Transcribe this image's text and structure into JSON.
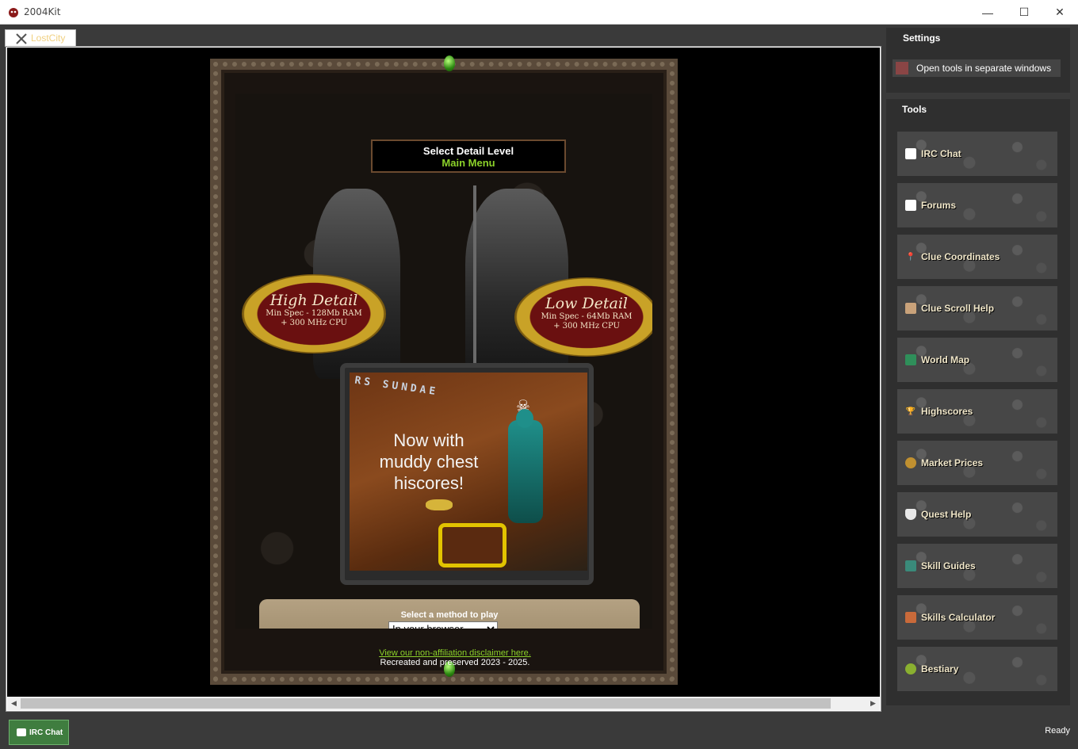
{
  "window": {
    "title": "2004Kit",
    "minimize": "—",
    "maximize": "☐",
    "close": "✕"
  },
  "tab": {
    "label": "LostCity"
  },
  "game": {
    "detail_title": "Select Detail Level",
    "detail_subtitle": "Main Menu",
    "high": {
      "title": "High Detail",
      "spec1": "Min Spec - 128Mb RAM",
      "spec2": "+ 300 MHz CPU"
    },
    "low": {
      "title": "Low Detail",
      "spec1": "Min Spec - 64Mb RAM",
      "spec2": "+ 300 MHz CPU"
    },
    "promo": {
      "logo": "RS SUNDAE",
      "headline": "Now with muddy chest hiscores!"
    },
    "method_label": "Select a method to play",
    "method_selected": "In your browser",
    "disclaimer_link": "View our non-affiliation disclaimer here.",
    "copyright": "Recreated and preserved 2023 - 2025."
  },
  "settings": {
    "title": "Settings",
    "toggle_label": "Open tools in separate windows"
  },
  "tools": {
    "title": "Tools",
    "items": [
      {
        "label": "IRC Chat",
        "icon": "chat-icon"
      },
      {
        "label": "Forums",
        "icon": "chat-icon"
      },
      {
        "label": "Clue Coordinates",
        "icon": "pin-icon"
      },
      {
        "label": "Clue Scroll Help",
        "icon": "scroll-icon"
      },
      {
        "label": "World Map",
        "icon": "map-icon"
      },
      {
        "label": "Highscores",
        "icon": "trophy-icon"
      },
      {
        "label": "Market Prices",
        "icon": "moneybag-icon"
      },
      {
        "label": "Quest Help",
        "icon": "shield-icon"
      },
      {
        "label": "Skill Guides",
        "icon": "book-icon"
      },
      {
        "label": "Skills Calculator",
        "icon": "calculator-icon"
      },
      {
        "label": "Bestiary",
        "icon": "creature-icon"
      }
    ]
  },
  "bottom": {
    "irc_button": "IRC Chat",
    "status": "Ready"
  }
}
